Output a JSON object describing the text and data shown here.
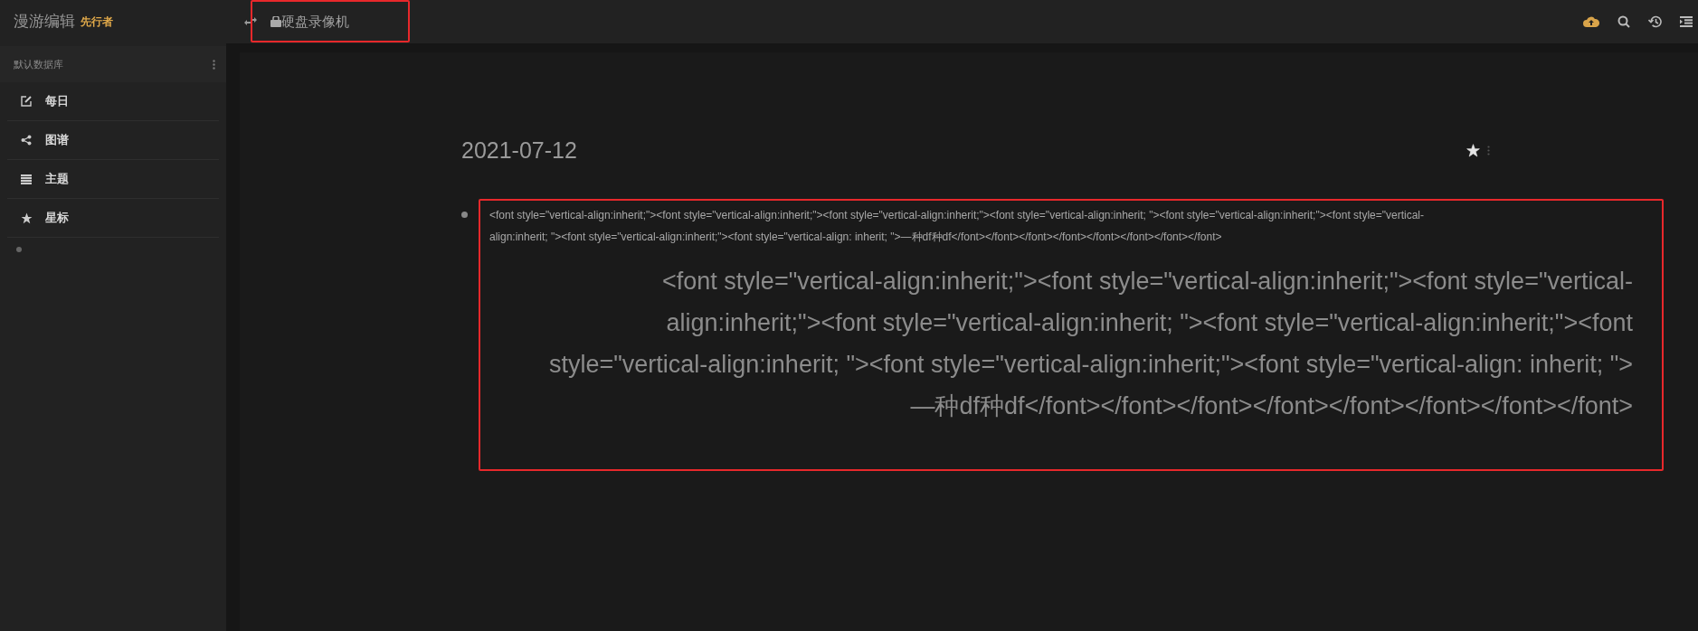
{
  "app": {
    "name": "漫游编辑",
    "badge": "先行者"
  },
  "page_title": "硬盘录像机",
  "sidebar": {
    "database": "默认数据库",
    "items": [
      {
        "label": "每日",
        "kind": "daily"
      },
      {
        "label": "图谱",
        "kind": "graph"
      },
      {
        "label": "主题",
        "kind": "topics"
      },
      {
        "label": "星标",
        "kind": "starred"
      }
    ]
  },
  "page": {
    "date": "2021-07-12",
    "starred": true,
    "blocks": [
      {
        "kind": "small",
        "text": "<font style=\"vertical-align:inherit;\"><font style=\"vertical-align:inherit;\"><font style=\"vertical-align:inherit;\"><font style=\"vertical-align:inherit; \"><font style=\"vertical-align:inherit;\"><font style=\"vertical-align:inherit; \"><font style=\"vertical-align:inherit;\"><font style=\"vertical-align: inherit; \">—种df种df</font></font></font></font></font></font></font></font>"
      },
      {
        "kind": "large",
        "text": "<font style=\"vertical-align:inherit;\"><font style=\"vertical-align:inherit;\"><font style=\"vertical-align:inherit;\"><font style=\"vertical-align:inherit; \"><font style=\"vertical-align:inherit;\"><font style=\"vertical-align:inherit; \"><font style=\"vertical-align:inherit;\"><font style=\"vertical-align: inherit; \">—种df种df</font></font></font></font></font></font></font></font>"
      }
    ]
  }
}
